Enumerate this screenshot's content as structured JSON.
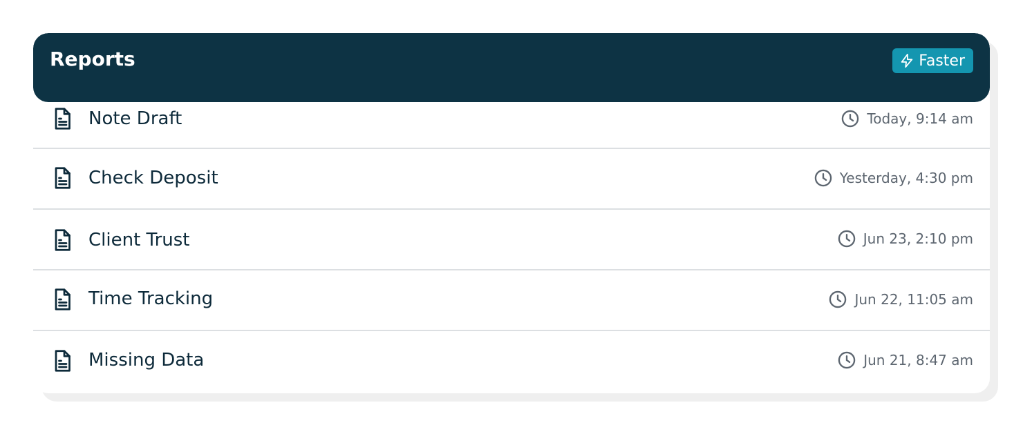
{
  "header": {
    "title": "Reports",
    "badge_label": "Faster",
    "badge_icon": "lightning-icon"
  },
  "colors": {
    "header_bg": "#0d3344",
    "badge_bg": "#1496b0",
    "text_primary": "#0d2a3a",
    "text_secondary": "#5d6670",
    "divider": "#dcdfe2"
  },
  "reports": [
    {
      "name": "Note Draft",
      "time": "Today, 9:14 am",
      "icon": "document-icon"
    },
    {
      "name": "Check Deposit",
      "time": "Yesterday, 4:30 pm",
      "icon": "document-icon"
    },
    {
      "name": "Client Trust",
      "time": "Jun 23, 2:10 pm",
      "icon": "document-icon"
    },
    {
      "name": "Time Tracking",
      "time": "Jun 22, 11:05 am",
      "icon": "document-icon"
    },
    {
      "name": "Missing Data",
      "time": "Jun 21, 8:47 am",
      "icon": "document-icon"
    }
  ]
}
